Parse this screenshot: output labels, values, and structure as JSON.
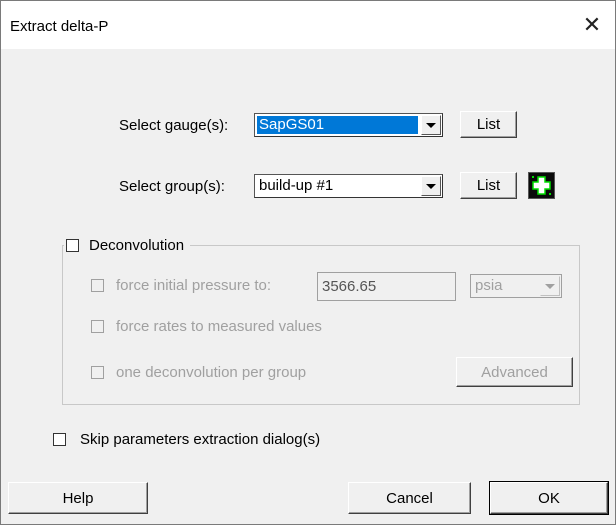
{
  "dialog": {
    "title": "Extract delta-P",
    "close_icon": "close-icon"
  },
  "gauge": {
    "label": "Select gauge(s):",
    "value": "SapGS01",
    "list_button": "List"
  },
  "group": {
    "label": "Select group(s):",
    "value": "build-up #1",
    "list_button": "List",
    "add_icon": "plus-icon"
  },
  "deconvolution": {
    "label": "Deconvolution",
    "checked": false,
    "force_initial_pressure": {
      "label": "force initial pressure to:",
      "value": "3566.65",
      "unit": "psia"
    },
    "force_rates_label": "force rates to measured values",
    "one_per_group_label": "one deconvolution per group",
    "advanced_button": "Advanced"
  },
  "skip": {
    "label": "Skip parameters extraction dialog(s)",
    "checked": false
  },
  "footer": {
    "help": "Help",
    "cancel": "Cancel",
    "ok": "OK"
  },
  "colors": {
    "selection": "#0078d7",
    "dialog_bg": "#f0f0f0",
    "disabled_text": "#a0a0a0",
    "plus_icon_green": "#00e000"
  }
}
